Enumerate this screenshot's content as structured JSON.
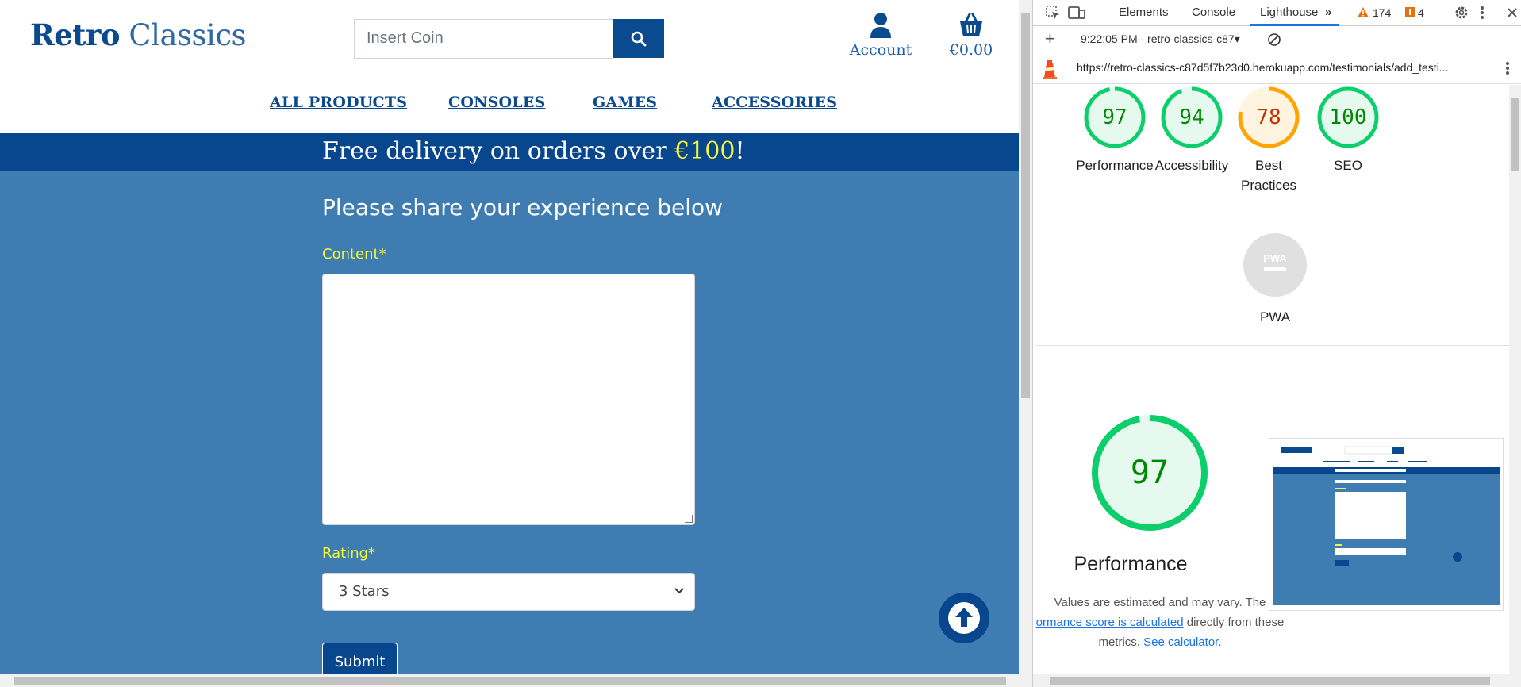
{
  "site": {
    "logo_bold": "Retro",
    "logo_light": "Classics",
    "search_placeholder": "Insert Coin",
    "account_label": "Account",
    "cart_total": "€0.00",
    "nav": [
      "ALL PRODUCTS",
      "CONSOLES",
      "GAMES",
      "ACCESSORIES"
    ],
    "banner_prefix": "Free delivery on orders over ",
    "banner_amount": "€100",
    "banner_suffix": "!",
    "form_title": "Please share your experience below",
    "content_label": "Content*",
    "rating_label": "Rating*",
    "rating_value": "3 Stars",
    "submit_label": "Submit",
    "colors": {
      "brand": "#08468d",
      "page_bg": "#3e7cb1",
      "label": "#f2f73c"
    }
  },
  "devtools": {
    "tabs": [
      "Elements",
      "Console",
      "Lighthouse"
    ],
    "active_tab": "Lighthouse",
    "warnings_count": "174",
    "errors_count": "4",
    "report_selector": "9:22:05 PM - retro-classics-c87",
    "url": "https://retro-classics-c87d5f7b23d0.herokuapp.com/testimonials/add_testi...",
    "scores": [
      {
        "label": "Performance",
        "value": 97,
        "color": "#0cce6b"
      },
      {
        "label": "Accessibility",
        "value": 94,
        "color": "#0cce6b"
      },
      {
        "label": "Best Practices",
        "value": 78,
        "color": "#ffa400"
      },
      {
        "label": "SEO",
        "value": 100,
        "color": "#0cce6b"
      }
    ],
    "pwa_label": "PWA",
    "pwa_badge": "PWA",
    "big_score": 97,
    "big_label": "Performance",
    "desc_line1": "Values are estimated and may vary. The",
    "desc_link1": "ormance score is calculated",
    "desc_line2": " directly from these",
    "desc_line3": "metrics. ",
    "desc_link2": "See calculator."
  }
}
